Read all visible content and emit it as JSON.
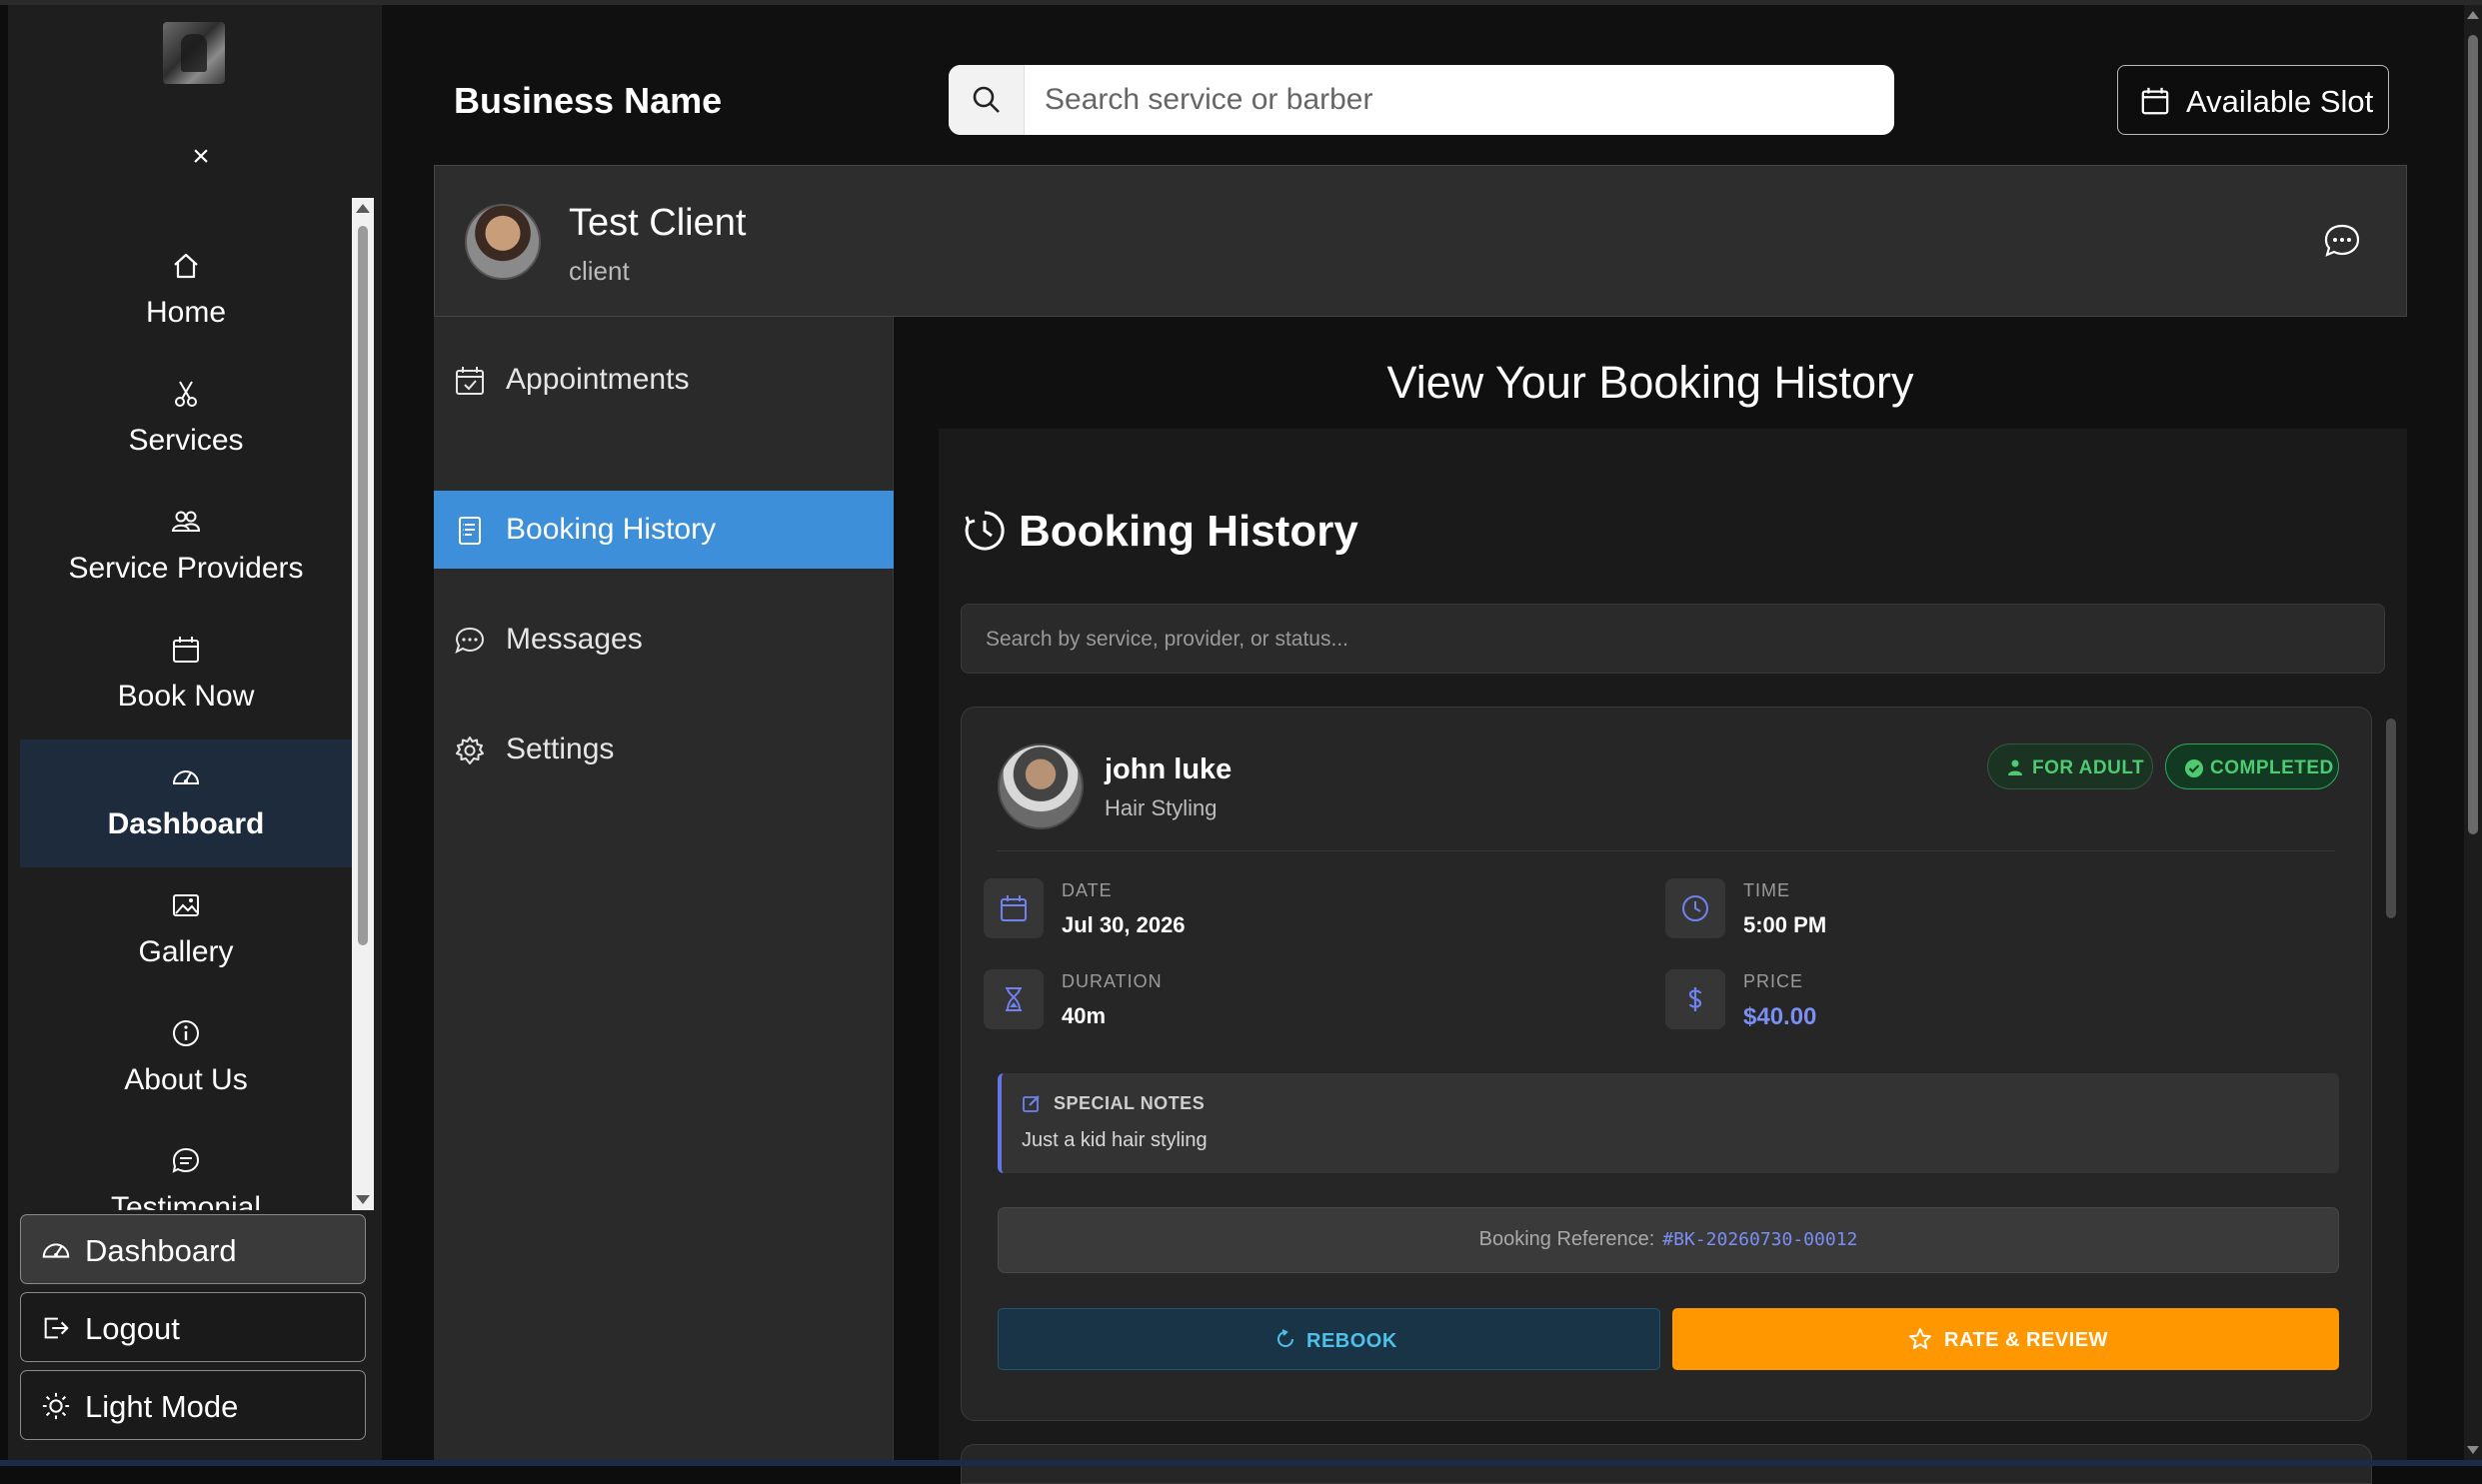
{
  "sidebar": {
    "close_glyph": "×",
    "nav": [
      {
        "label": "Home",
        "icon": "home-icon"
      },
      {
        "label": "Services",
        "icon": "scissors-icon"
      },
      {
        "label": "Service Providers",
        "icon": "users-icon"
      },
      {
        "label": "Book Now",
        "icon": "calendar-icon"
      },
      {
        "label": "Dashboard",
        "icon": "speedometer-icon",
        "active": true
      },
      {
        "label": "Gallery",
        "icon": "image-icon"
      },
      {
        "label": "About Us",
        "icon": "info-icon"
      },
      {
        "label": "Testimonial",
        "icon": "chat-icon"
      }
    ],
    "buttons": [
      {
        "label": "Dashboard",
        "icon": "speedometer-icon",
        "active": true
      },
      {
        "label": "Logout",
        "icon": "logout-icon"
      },
      {
        "label": "Light Mode",
        "icon": "sun-icon"
      }
    ]
  },
  "header": {
    "business_name": "Business Name",
    "search_placeholder": "Search service or barber",
    "available_slot": "Available Slot"
  },
  "profile": {
    "name": "Test Client",
    "role": "client"
  },
  "menu": [
    {
      "label": "Appointments",
      "icon": "calendar-check-icon"
    },
    {
      "label": "Booking History",
      "icon": "receipt-icon",
      "active": true
    },
    {
      "label": "Messages",
      "icon": "chat-dots-icon"
    },
    {
      "label": "Settings",
      "icon": "gear-icon"
    }
  ],
  "content": {
    "title": "View Your Booking History",
    "section_title": "Booking History",
    "search_placeholder": "Search by service, provider, or status..."
  },
  "booking": {
    "provider": "john luke",
    "service": "Hair Styling",
    "badge_audience": "FOR ADULT",
    "badge_status": "COMPLETED",
    "date_label": "DATE",
    "date": "Jul 30, 2026",
    "time_label": "TIME",
    "time": "5:00 PM",
    "duration_label": "DURATION",
    "duration": "40m",
    "price_label": "PRICE",
    "price": "$40.00",
    "notes_label": "SPECIAL NOTES",
    "notes": "Just a kid hair styling",
    "ref_label": "Booking Reference:",
    "ref_code": "#BK-20260730-00012",
    "rebook": "REBOOK",
    "rate": "RATE & REVIEW"
  },
  "colors": {
    "accent_blue": "#3d8fd9",
    "price_blue": "#7b8ff2",
    "success_green": "#4ecb71",
    "rate_orange": "#ff9800",
    "rebook_cyan": "#4fc1e9"
  }
}
